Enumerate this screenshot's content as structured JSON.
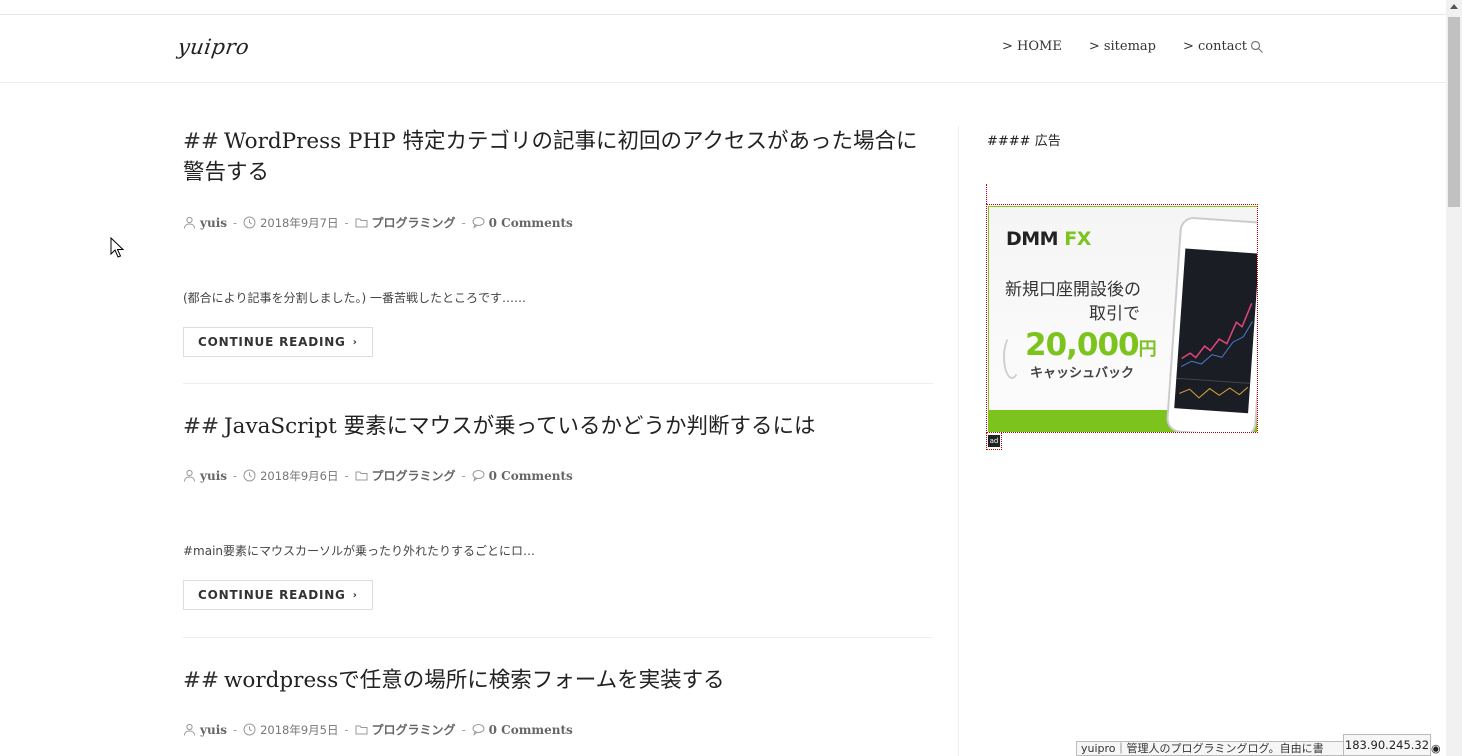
{
  "site": {
    "logo": "yuipro"
  },
  "nav": {
    "items": [
      {
        "label": "> HOME"
      },
      {
        "label": "> sitemap"
      },
      {
        "label": "> contact"
      }
    ],
    "search_icon": "search-icon"
  },
  "posts": [
    {
      "hash": "##",
      "title": "WordPress PHP 特定カテゴリの記事に初回のアクセスがあった場合に警告する",
      "author": "yuis",
      "date": "2018年9月7日",
      "category": "プログラミング",
      "comments": "0 Comments",
      "excerpt": "(都合により記事を分割しました。) 一番苦戦したところです……",
      "button": "CONTINUE READING"
    },
    {
      "hash": "##",
      "title": "JavaScript 要素にマウスが乗っているかどうか判断するには",
      "author": "yuis",
      "date": "2018年9月6日",
      "category": "プログラミング",
      "comments": "0 Comments",
      "excerpt": "#main要素にマウスカーソルが乗ったり外れたりするごとにロ…",
      "button": "CONTINUE READING"
    },
    {
      "hash": "##",
      "title": "wordpressで任意の場所に検索フォームを実装する",
      "author": "yuis",
      "date": "2018年9月5日",
      "category": "プログラミング",
      "comments": "0 Comments"
    }
  ],
  "sidebar": {
    "widget_title": "#### 広告",
    "ad": {
      "brand": "DMM",
      "brand_fx": "FX",
      "line1": "新規口座開設後の",
      "line2": "取引で",
      "amount": "20,000",
      "yen": "円",
      "cashback": "キャッシュバック",
      "badge": "ad",
      "accent": "#7cc31d"
    }
  },
  "status": {
    "tooltip": "yuipro｜管理人のプログラミングログ。自由に書",
    "ip": "183.90.245.32"
  }
}
